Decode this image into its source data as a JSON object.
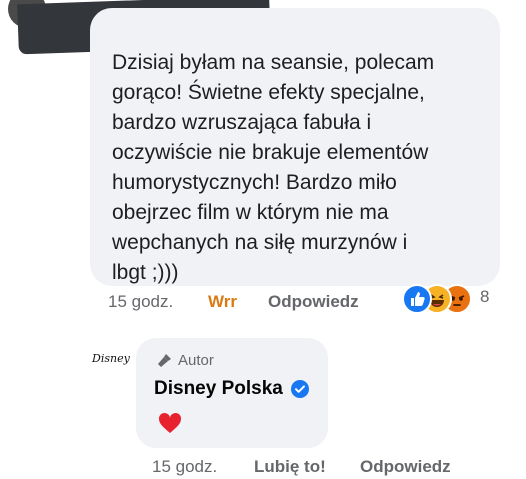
{
  "comment": {
    "text": "Dzisiaj byłam na seansie, polecam\ngorąco! Świetne efekty specjalne,\nbardzo wzruszająca fabuła i\noczywiście nie brakuje elementów\nhumorystycznych! Bardzo miło\nobejrzec film w którym nie ma\nwepchanych na siłę murzynów i\nlbgt ;)))",
    "time": "15 godz.",
    "reaction_label": "Wrr",
    "reply_label": "Odpowiedz",
    "reactions": {
      "icons": [
        "like-icon",
        "haha-icon",
        "angry-icon"
      ],
      "count": "8",
      "colors": {
        "like": "#1877f2",
        "haha": "#f7b125",
        "angry": "#e9710f"
      }
    },
    "reaction_color": "#d97a13"
  },
  "reply": {
    "avatar_logo_text": "Disney",
    "badge": "Autor",
    "author": "Disney Polska",
    "content_icon": "red-heart-icon",
    "time": "15 godz.",
    "like_label": "Lubię to!",
    "reply_label": "Odpowiedz"
  },
  "colors": {
    "bubble_bg": "#f0f2f5",
    "meta_text": "#65676b",
    "verified": "#1877f2",
    "heart": "#e8212e"
  }
}
